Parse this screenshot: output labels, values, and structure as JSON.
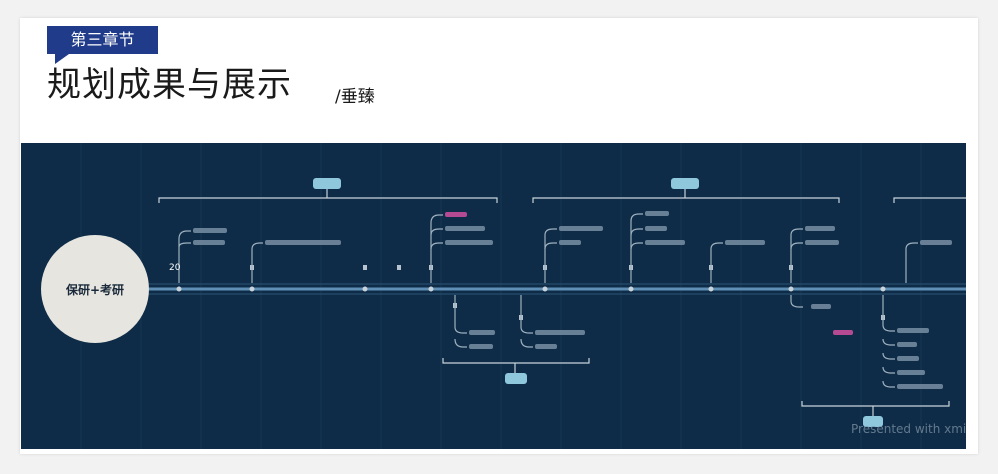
{
  "header": {
    "chapter_badge": "第三章节",
    "title": "规划成果与展示",
    "subtitle": "/垂臻"
  },
  "mindmap": {
    "center_label": "保研+考研",
    "year_label": "20",
    "watermark": "Presented with xmind"
  },
  "colors": {
    "badge_bg": "#1f3b8a",
    "map_bg": "#0e2c47",
    "timeline": "#5f8fb4",
    "branch": "#c9d3dc",
    "tag_bg": "#8fc8dc",
    "highlight_pink": "#d24fa0"
  }
}
